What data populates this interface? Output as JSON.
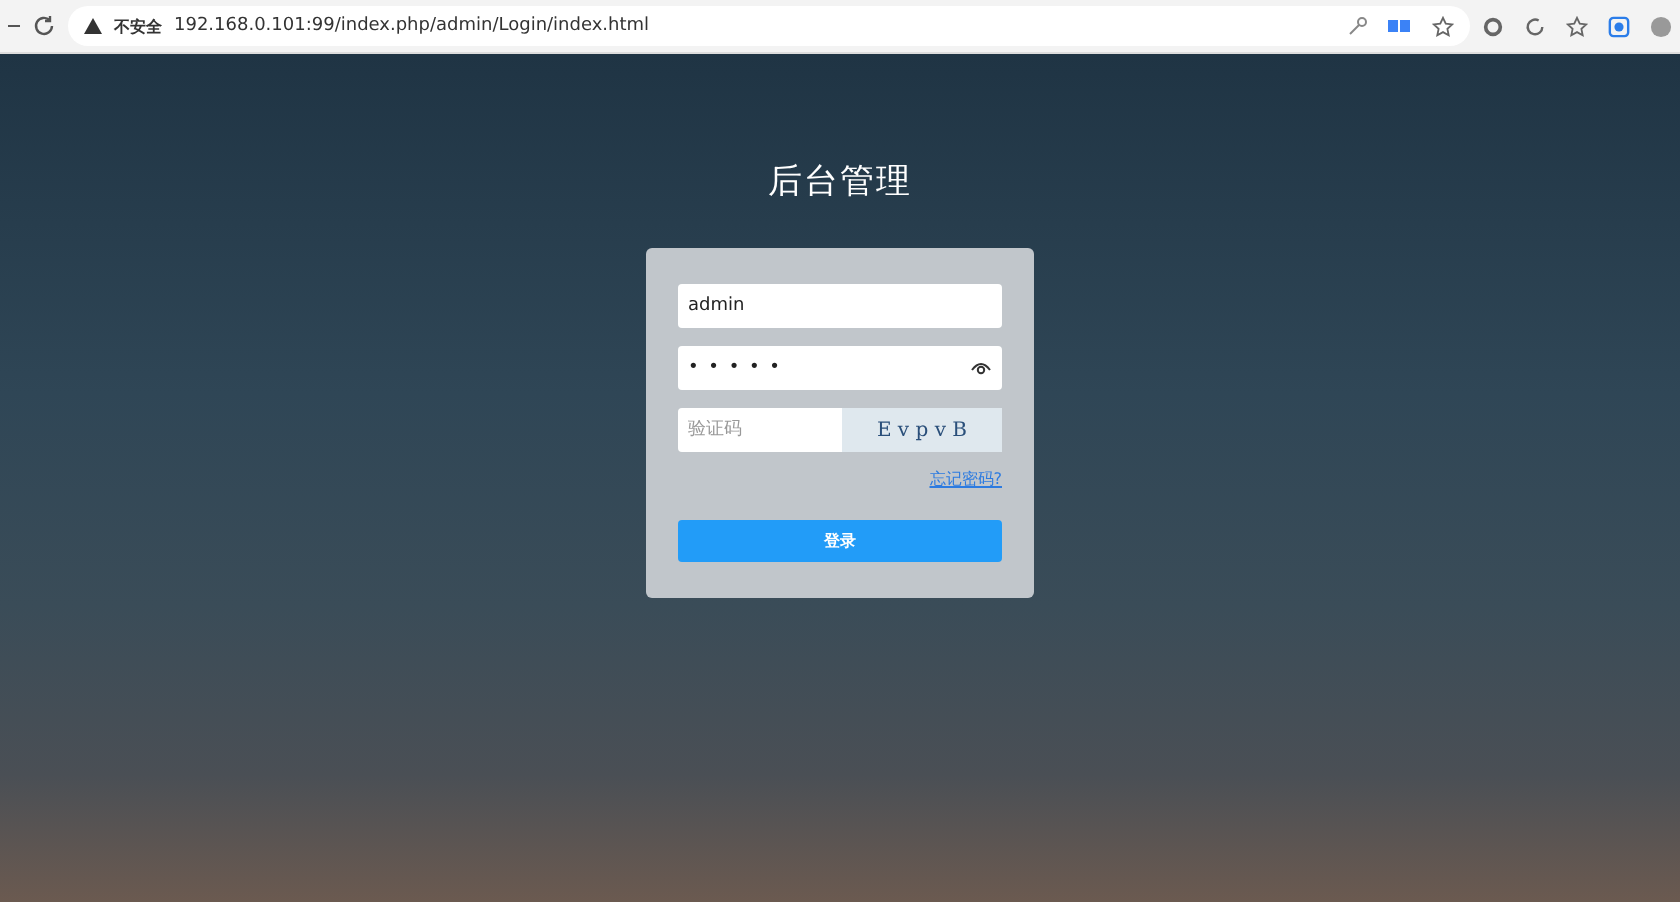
{
  "browser": {
    "security_label": "不安全",
    "url": "192.168.0.101:99/index.php/admin/Login/index.html"
  },
  "login": {
    "title": "后台管理",
    "username": {
      "value": "admin"
    },
    "password": {
      "masked": "• • • • •"
    },
    "captcha": {
      "placeholder": "验证码",
      "code": "E v p v B"
    },
    "forgot_link": "忘记密码?",
    "submit": "登录"
  }
}
